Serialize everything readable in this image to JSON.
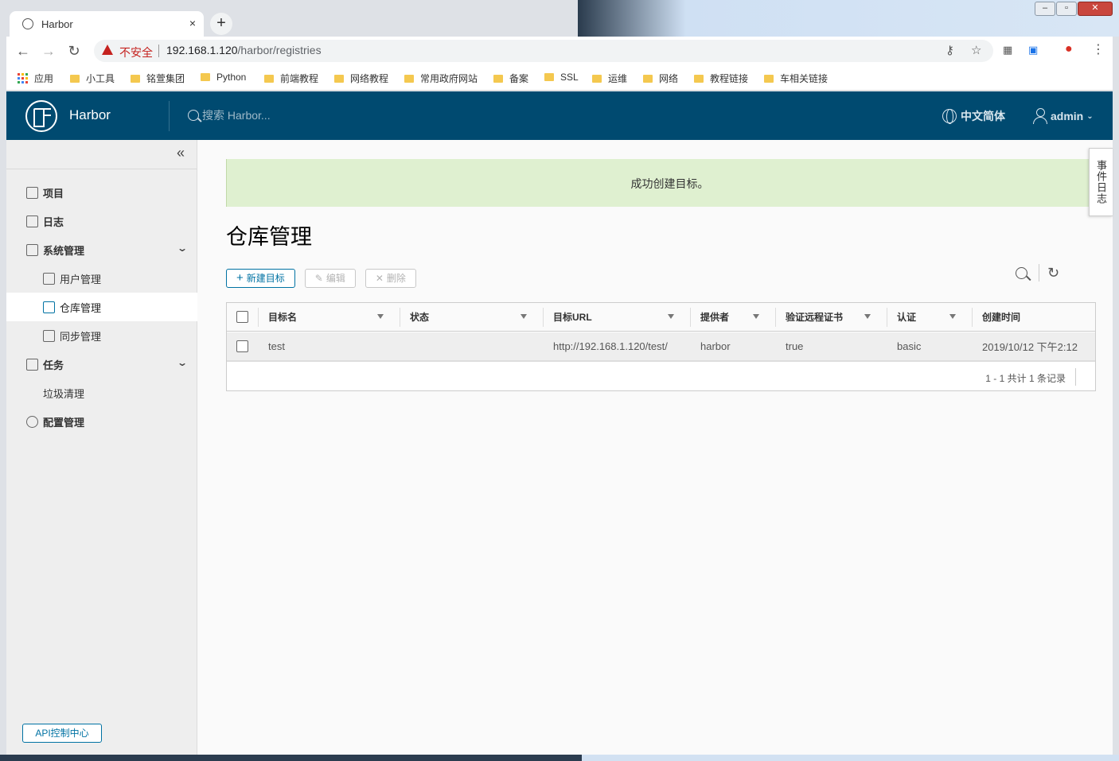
{
  "browser": {
    "tab_title": "Harbor",
    "tab_close": "×",
    "new_tab": "+",
    "insecure_label": "不安全",
    "url_host": "192.168.1.120",
    "url_path": "/harbor/registries",
    "bookmarks": [
      {
        "label": "应用",
        "type": "apps"
      },
      {
        "label": "小工具",
        "type": "folder"
      },
      {
        "label": "铭萱集团",
        "type": "folder"
      },
      {
        "label": "Python",
        "type": "folder"
      },
      {
        "label": "前端教程",
        "type": "folder"
      },
      {
        "label": "网络教程",
        "type": "folder"
      },
      {
        "label": "常用政府网站",
        "type": "folder"
      },
      {
        "label": "备案",
        "type": "folder"
      },
      {
        "label": "SSL",
        "type": "folder"
      },
      {
        "label": "运维",
        "type": "folder"
      },
      {
        "label": "网络",
        "type": "folder"
      },
      {
        "label": "教程链接",
        "type": "folder"
      },
      {
        "label": "车相关链接",
        "type": "folder"
      }
    ]
  },
  "header": {
    "brand": "Harbor",
    "search_placeholder": "搜索 Harbor...",
    "language": "中文简体",
    "user": "admin"
  },
  "sidebar": {
    "items": [
      {
        "label": "项目",
        "level": "top"
      },
      {
        "label": "日志",
        "level": "top"
      },
      {
        "label": "系统管理",
        "level": "top",
        "expandable": true
      },
      {
        "label": "用户管理",
        "level": "sub"
      },
      {
        "label": "仓库管理",
        "level": "sub",
        "active": true
      },
      {
        "label": "同步管理",
        "level": "sub"
      },
      {
        "label": "任务",
        "level": "top",
        "expandable": true
      },
      {
        "label": "垃圾清理",
        "level": "sub"
      },
      {
        "label": "配置管理",
        "level": "top"
      }
    ],
    "api_button": "API控制中心"
  },
  "alert": {
    "message": "成功创建目标。",
    "close": "×"
  },
  "events_tab": "事件日志",
  "page": {
    "title": "仓库管理",
    "actions": {
      "new": "新建目标",
      "edit": "编辑",
      "delete": "删除"
    }
  },
  "table": {
    "columns": [
      "目标名",
      "状态",
      "目标URL",
      "提供者",
      "验证远程证书",
      "认证",
      "创建时间"
    ],
    "rows": [
      [
        "test",
        "",
        "http://192.168.1.120/test/",
        "harbor",
        "true",
        "basic",
        "2019/10/12 下午2:12"
      ]
    ],
    "footer": "1 - 1 共计 1 条记录"
  },
  "colors": {
    "header_bg": "#004a70",
    "accent": "#0072a3",
    "success_bg": "#dff0d0",
    "insecure": "#c5221f"
  }
}
